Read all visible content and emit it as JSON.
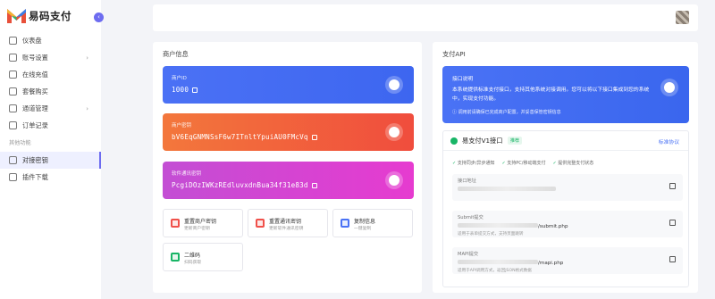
{
  "brand": {
    "name": "易码支付"
  },
  "sidebar": {
    "items": [
      {
        "label": "仪表盘",
        "icon": "home-icon",
        "arrow": false
      },
      {
        "label": "账号设置",
        "icon": "user-icon",
        "arrow": true
      },
      {
        "label": "在线充值",
        "icon": "wallet-icon",
        "arrow": false
      },
      {
        "label": "套餐购买",
        "icon": "package-icon",
        "arrow": false
      },
      {
        "label": "通道管理",
        "icon": "channel-icon",
        "arrow": true
      },
      {
        "label": "订单记录",
        "icon": "order-icon",
        "arrow": false
      }
    ],
    "section_title": "其他功能",
    "other_items": [
      {
        "label": "对接密钥",
        "icon": "key-icon",
        "active": true
      },
      {
        "label": "插件下载",
        "icon": "download-icon",
        "active": false
      }
    ]
  },
  "merchant": {
    "title": "商户信息",
    "cards": [
      {
        "label": "商户ID",
        "value": "1000",
        "icon": "user-circle-icon"
      },
      {
        "label": "商户密钥",
        "value": "bV6EqGNMNSsF6w7ITnltYpuiAU0FMcVq",
        "icon": "keypad-icon"
      },
      {
        "label": "软件通讯密钥",
        "value": "PcgiDOzIWKzREdluvxdnBua34f31e83d",
        "icon": "keypad-icon"
      }
    ],
    "actions": [
      {
        "title": "重置商户密钥",
        "sub": "更新商户密钥",
        "color": "#f0504a"
      },
      {
        "title": "重置通讯密钥",
        "sub": "更新软件通讯密钥",
        "color": "#f0504a"
      },
      {
        "title": "复制信息",
        "sub": "一键复制",
        "color": "#4a72f5"
      },
      {
        "title": "二维码",
        "sub": "扫码获取",
        "color": "#18b566"
      }
    ]
  },
  "api": {
    "title": "支付API",
    "intro_title": "接口说明",
    "intro_desc": "本系统提供标准支付接口，支持其他系统对接调用。您可以将以下接口集成到您的系统中，实现支付功能。",
    "intro_note": "调用前请确保已完成商户配置，并妥善保管密钥信息",
    "interface_name": "易支付V1接口",
    "recommend": "推荐",
    "protocol": "标准协议",
    "features": [
      "支持同步/异步通知",
      "支持PC/移动端支付",
      "提供完整支付状态"
    ],
    "fields": [
      {
        "label": "接口地址",
        "value": "",
        "note": ""
      },
      {
        "label": "Submit提交",
        "value": "/submit.php",
        "note": "适用于表单提交方式，支持页面跳转"
      },
      {
        "label": "MAPI提交",
        "value": "/mapi.php",
        "note": "适用于API调用方式，返回JSON格式数据"
      }
    ]
  },
  "colors": {
    "accent": "#6d6cf0",
    "blue": "#4a72f5",
    "orange": "#f3773c",
    "magenta": "#d44bd2",
    "green": "#18b566"
  }
}
